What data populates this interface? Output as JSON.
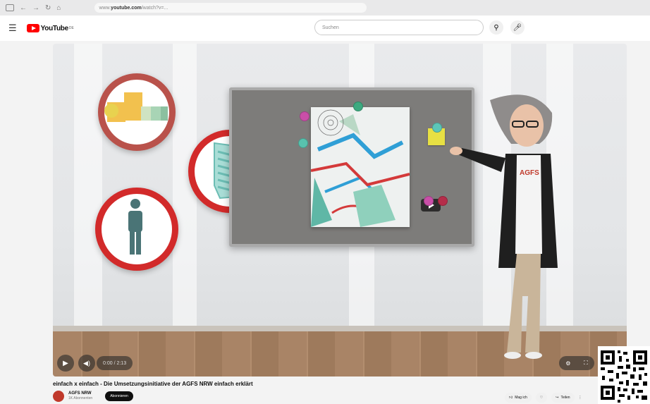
{
  "browser": {
    "url_prefix": "www.",
    "url_host": "youtube.com",
    "url_path": "/watch?v=..."
  },
  "header": {
    "logo_text": "YouTube",
    "logo_sup": "DE",
    "search_placeholder": "Suchen"
  },
  "video": {
    "title": "einfach x einfach - Die Umsetzungsinitiative der AGFS NRW einfach erklärt",
    "time": "0:00 / 2:13",
    "shirt_text": "AGFS"
  },
  "channel": {
    "name": "AGFS NRW",
    "subscribers": "1K Abonnenten",
    "subscribe_label": "Abonnieren"
  },
  "actions": {
    "like_label": "Mag ich",
    "share_label": "Teilen"
  },
  "colors": {
    "accent": "#ff0000",
    "sign_red": "#d22a2a"
  },
  "icons": [
    "menu-icon",
    "search-icon",
    "mic-icon",
    "play-icon",
    "volume-icon",
    "settings-icon",
    "fullscreen-icon",
    "like-icon",
    "dislike-icon",
    "share-icon",
    "more-icon",
    "qr-code"
  ]
}
